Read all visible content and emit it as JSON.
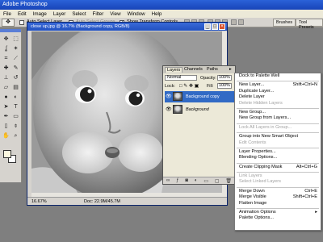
{
  "app": {
    "title": "Adobe Photoshop"
  },
  "menubar": [
    "File",
    "Edit",
    "Image",
    "Layer",
    "Select",
    "Filter",
    "View",
    "Window",
    "Help"
  ],
  "options": {
    "auto_select_layer": "Auto Select Layer",
    "auto_select_groups": "Auto Select Groups",
    "show_transform_controls": "Show Transform Controls"
  },
  "palette_well": {
    "tabs": [
      "Brushes",
      "Tool Presets"
    ]
  },
  "toolbox": {
    "tools": [
      "move-tool-icon",
      "marquee-tool-icon",
      "lasso-tool-icon",
      "magic-wand-icon",
      "crop-tool-icon",
      "slice-tool-icon",
      "healing-brush-icon",
      "brush-tool-icon",
      "clone-stamp-icon",
      "history-brush-icon",
      "eraser-tool-icon",
      "gradient-tool-icon",
      "blur-tool-icon",
      "dodge-tool-icon",
      "path-selection-icon",
      "type-tool-icon",
      "pen-tool-icon",
      "shape-tool-icon",
      "notes-tool-icon",
      "eyedropper-icon",
      "hand-tool-icon",
      "zoom-tool-icon"
    ],
    "foreground_color": "#fcf8e0",
    "background_color": "#ffffff"
  },
  "document": {
    "title": "close up.jpg @ 16.7% (Background copy, RGB/8)",
    "zoom": "16.67%",
    "doc_size": "Doc: 22.9M/45.7M"
  },
  "layers_panel": {
    "tabs": [
      "Layers",
      "Channels",
      "Paths"
    ],
    "blend_mode": "Normal",
    "opacity_label": "Opacity:",
    "opacity_value": "100%",
    "lock_label": "Lock:",
    "fill_label": "Fill:",
    "fill_value": "100%",
    "layers": [
      {
        "name": "Background copy",
        "selected": true
      },
      {
        "name": "Background",
        "selected": false
      }
    ]
  },
  "context_menu": {
    "items": [
      {
        "label": "Dock to Palette Well",
        "shortcut": "",
        "disabled": false
      },
      {
        "sep": true
      },
      {
        "label": "New Layer...",
        "shortcut": "Shift+Ctrl+N",
        "disabled": false
      },
      {
        "label": "Duplicate Layer...",
        "shortcut": "",
        "disabled": false
      },
      {
        "label": "Delete Layer",
        "shortcut": "",
        "disabled": false
      },
      {
        "label": "Delete Hidden Layers",
        "shortcut": "",
        "disabled": true
      },
      {
        "sep": true
      },
      {
        "label": "New Group...",
        "shortcut": "",
        "disabled": false
      },
      {
        "label": "New Group from Layers...",
        "shortcut": "",
        "disabled": false
      },
      {
        "sep": true
      },
      {
        "label": "Lock All Layers in Group...",
        "shortcut": "",
        "disabled": true
      },
      {
        "sep": true
      },
      {
        "label": "Group into New Smart Object",
        "shortcut": "",
        "disabled": false
      },
      {
        "label": "Edit Contents",
        "shortcut": "",
        "disabled": true
      },
      {
        "sep": true
      },
      {
        "label": "Layer Properties...",
        "shortcut": "",
        "disabled": false
      },
      {
        "label": "Blending Options...",
        "shortcut": "",
        "disabled": false
      },
      {
        "sep": true
      },
      {
        "label": "Create Clipping Mask",
        "shortcut": "Alt+Ctrl+G",
        "disabled": false
      },
      {
        "sep": true
      },
      {
        "label": "Link Layers",
        "shortcut": "",
        "disabled": true
      },
      {
        "label": "Select Linked Layers",
        "shortcut": "",
        "disabled": true
      },
      {
        "sep": true
      },
      {
        "label": "Merge Down",
        "shortcut": "Ctrl+E",
        "disabled": false
      },
      {
        "label": "Merge Visible",
        "shortcut": "Shift+Ctrl+E",
        "disabled": false
      },
      {
        "label": "Flatten Image",
        "shortcut": "",
        "disabled": false
      },
      {
        "sep": true
      },
      {
        "label": "Animation Options",
        "shortcut": "",
        "disabled": false,
        "submenu": true
      },
      {
        "label": "Palette Options...",
        "shortcut": "",
        "disabled": false
      }
    ]
  }
}
